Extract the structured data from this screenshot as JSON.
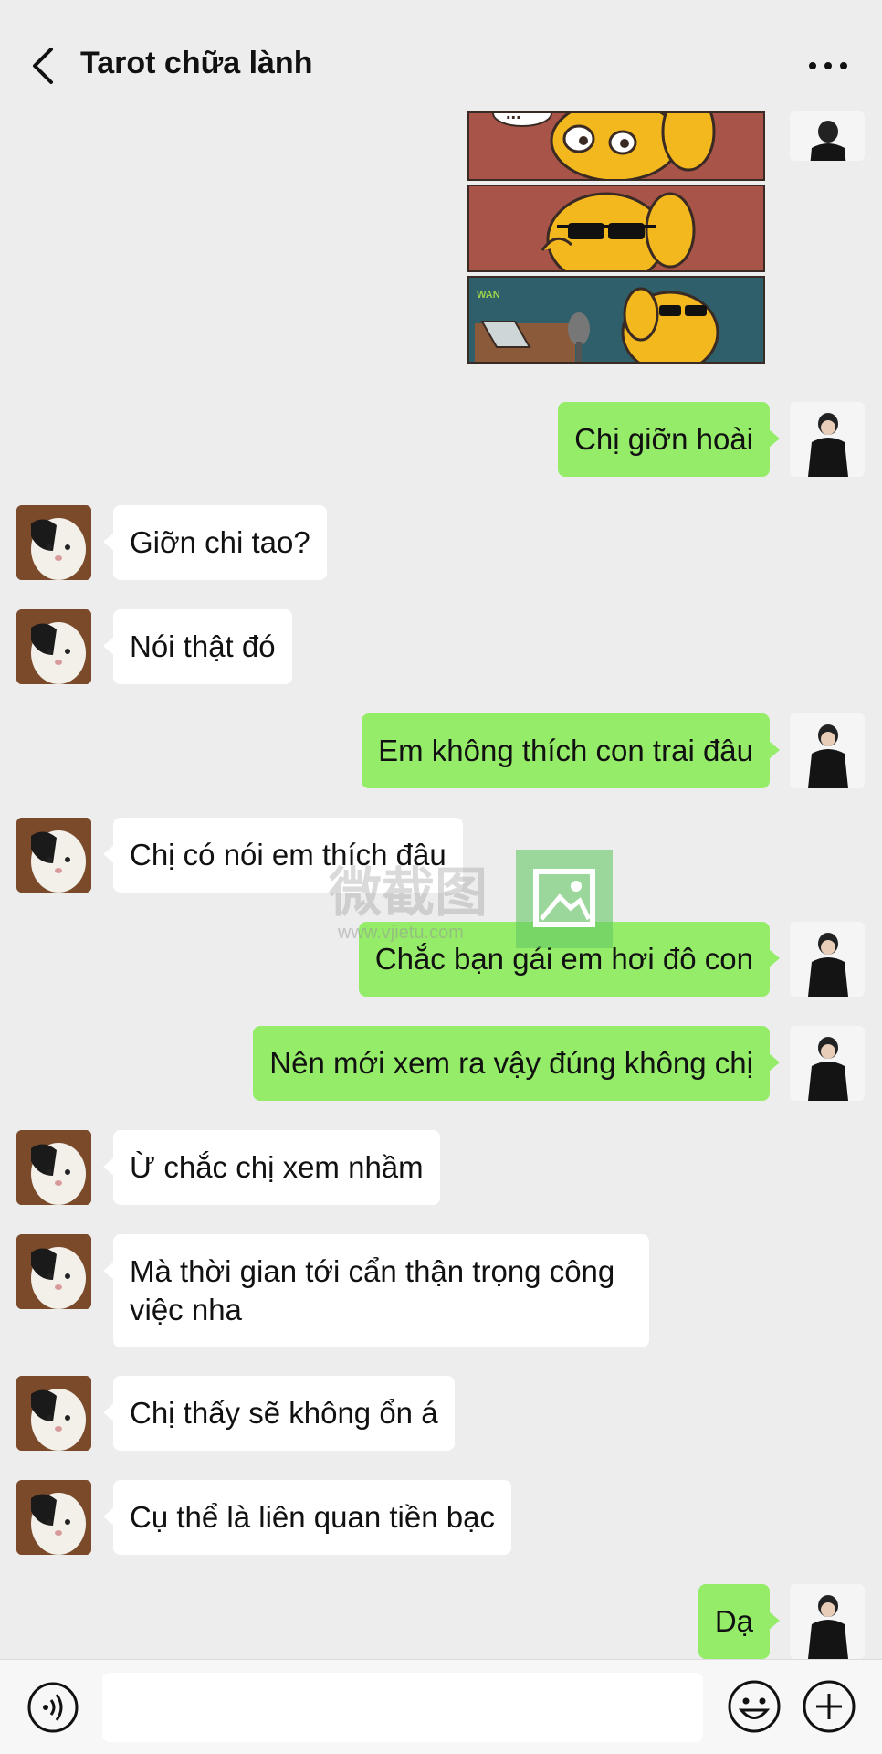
{
  "header": {
    "title": "Tarot chữa lành"
  },
  "messages": [
    {
      "from": "me",
      "text": "Chị giỡn hoài"
    },
    {
      "from": "her",
      "text": "Giỡn chi tao?"
    },
    {
      "from": "her",
      "text": "Nói thật đó"
    },
    {
      "from": "me",
      "text": "Em không thích con trai đâu"
    },
    {
      "from": "her",
      "text": "Chị có nói em thích đâu"
    },
    {
      "from": "me",
      "text": "Chắc bạn gái em hơi đô con"
    },
    {
      "from": "me",
      "text": "Nên mới xem ra vậy đúng không chị"
    },
    {
      "from": "her",
      "text": "Ừ chắc chị xem nhầm"
    },
    {
      "from": "her",
      "text": "Mà thời gian tới cẩn thận trọng công việc nha"
    },
    {
      "from": "her",
      "text": "Chị thấy sẽ không ổn á"
    },
    {
      "from": "her",
      "text": "Cụ thể là liên quan tiền bạc"
    },
    {
      "from": "me",
      "text": "Dạ"
    }
  ],
  "sticker": {
    "description_icon": "sunglasses-dog-sticker",
    "speech_text": "...",
    "corner_logo": "WAN"
  },
  "watermark": {
    "text": "微截图",
    "url": "www.vjietu.com"
  },
  "input_bar": {
    "placeholder": ""
  },
  "colors": {
    "my_bubble": "#95ec69",
    "her_bubble": "#ffffff",
    "background": "#ededed"
  }
}
